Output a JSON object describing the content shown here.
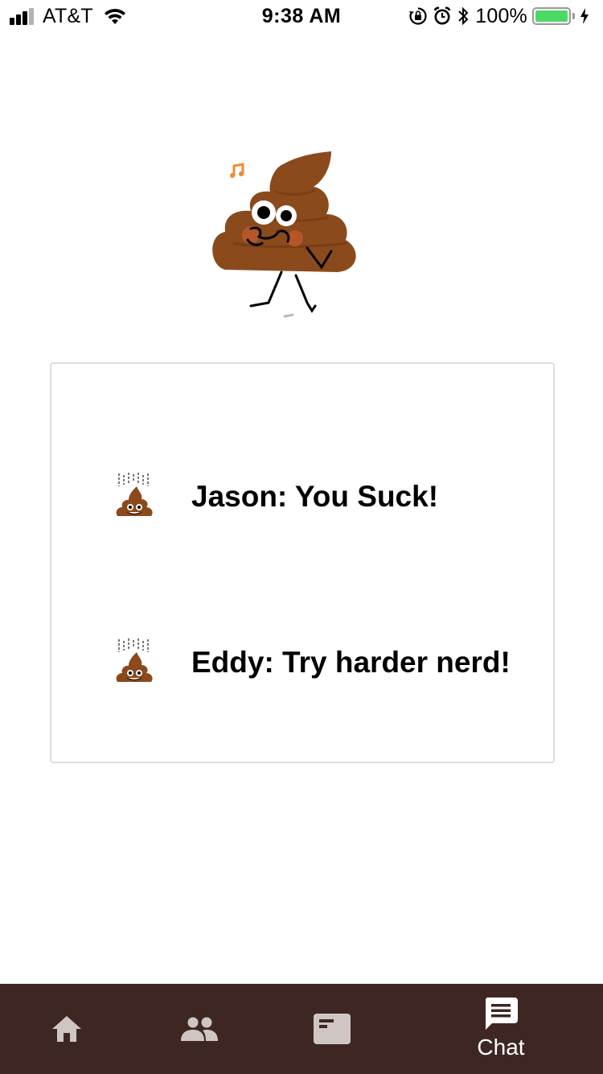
{
  "status_bar": {
    "carrier": "AT&T",
    "time": "9:38 AM",
    "battery_percent": "100%",
    "battery_level": 1.0,
    "signal_bars_active": 3,
    "signal_bars_total": 4,
    "icons": [
      "signal-icon",
      "wifi-icon",
      "orientation-lock-icon",
      "alarm-icon",
      "bluetooth-icon",
      "battery-icon",
      "charging-icon"
    ]
  },
  "hero": {
    "icon": "dancing-poop-illustration"
  },
  "chat": {
    "messages": [
      {
        "avatar_icon": "poop-emoji-icon",
        "text": "Jason: You Suck!"
      },
      {
        "avatar_icon": "poop-emoji-icon",
        "text": "Eddy: Try harder nerd!"
      }
    ]
  },
  "tab_bar": {
    "background": "#3e2723",
    "tabs": [
      {
        "icon": "home-icon",
        "label": "",
        "active": false
      },
      {
        "icon": "people-icon",
        "label": "",
        "active": false
      },
      {
        "icon": "card-icon",
        "label": "",
        "active": false
      },
      {
        "icon": "chat-icon",
        "label": "Chat",
        "active": true
      }
    ]
  },
  "colors": {
    "poop_brown": "#8b4a1c",
    "tab_inactive": "#cfc6c3",
    "tab_active": "#ffffff",
    "battery_green": "#4cd964"
  }
}
